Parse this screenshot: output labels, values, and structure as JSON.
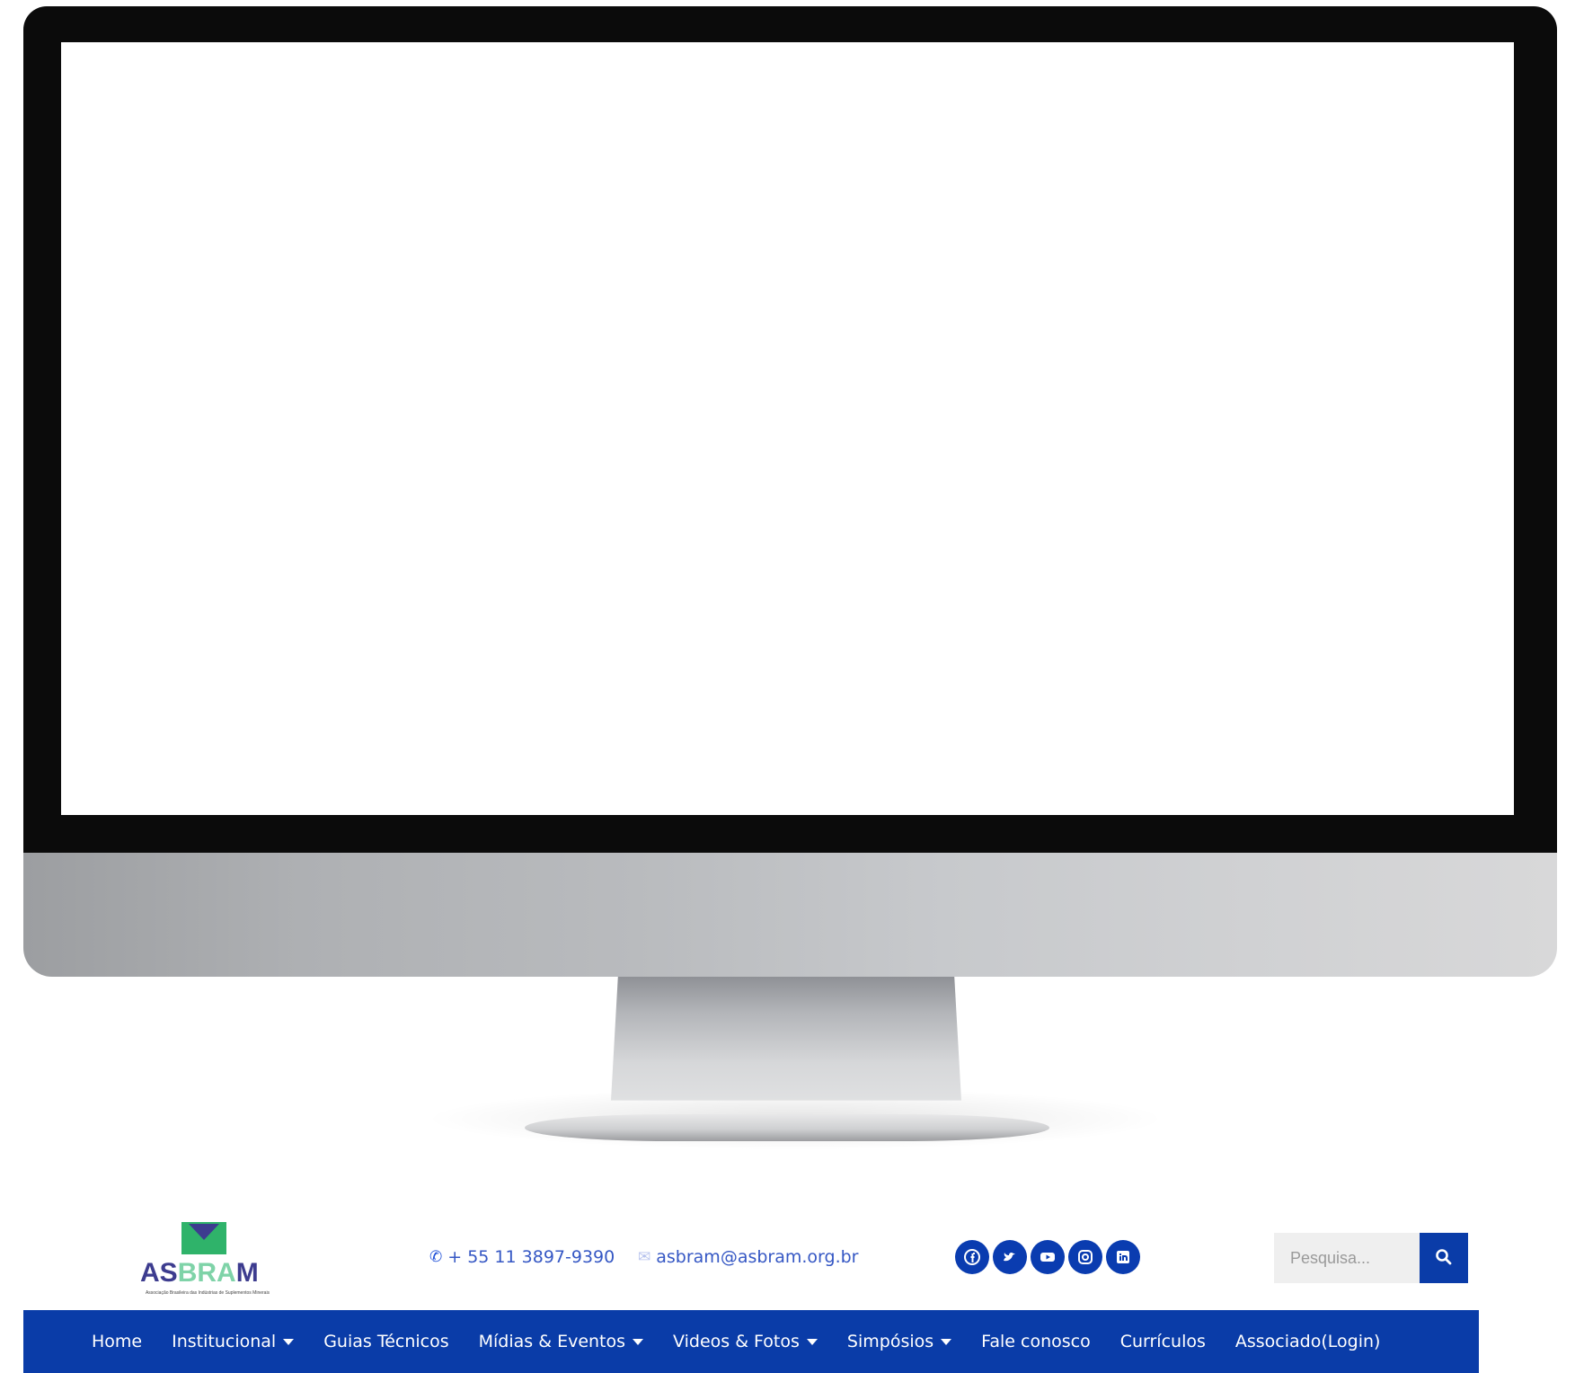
{
  "brand": {
    "logo_text_left": "AS",
    "logo_text_mid": "BRA",
    "logo_text_right": "M",
    "logo_subtitle": "Associação Brasileira das Indústrias de Suplementos Minerais",
    "colors": {
      "primary": "#0a3ca8",
      "logo_green": "#2fb36a",
      "logo_purple": "#3d3c8f"
    }
  },
  "contact": {
    "phone": "+ 55 11 3897-9390",
    "email": "asbram@asbram.org.br",
    "phone_icon": "phone-icon",
    "email_icon": "envelope-icon"
  },
  "socials": [
    {
      "icon": "facebook-icon"
    },
    {
      "icon": "twitter-icon"
    },
    {
      "icon": "youtube-icon"
    },
    {
      "icon": "instagram-icon"
    },
    {
      "icon": "linkedin-icon"
    }
  ],
  "search": {
    "placeholder": "Pesquisa...",
    "button_icon": "search-icon"
  },
  "nav": {
    "items": [
      {
        "label": "Home",
        "dropdown": false
      },
      {
        "label": "Institucional",
        "dropdown": true
      },
      {
        "label": "Guias Técnicos",
        "dropdown": false
      },
      {
        "label": "Mídias & Eventos",
        "dropdown": true
      },
      {
        "label": "Videos & Fotos",
        "dropdown": true
      },
      {
        "label": "Simpósios",
        "dropdown": true
      },
      {
        "label": "Fale conosco",
        "dropdown": false
      },
      {
        "label": "Currículos",
        "dropdown": false
      },
      {
        "label": "Associado(Login)",
        "dropdown": false
      }
    ]
  }
}
